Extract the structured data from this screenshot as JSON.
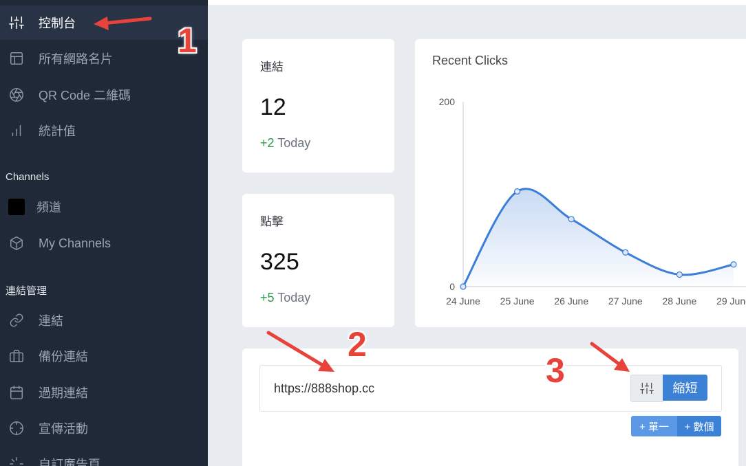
{
  "sidebar": {
    "items": [
      {
        "label": "控制台",
        "icon": "sliders-icon",
        "active": true
      },
      {
        "label": "所有網路名片",
        "icon": "layout-icon"
      },
      {
        "label": "QR Code 二維碼",
        "icon": "aperture-icon"
      },
      {
        "label": "統計值",
        "icon": "bar-chart-icon"
      }
    ],
    "channels_title": "Channels",
    "channels": [
      {
        "label": "頻道",
        "icon": "black-square-icon"
      },
      {
        "label": "My Channels",
        "icon": "box-icon"
      }
    ],
    "links_title": "連結管理",
    "links": [
      {
        "label": "連結",
        "icon": "link-icon"
      },
      {
        "label": "備份連結",
        "icon": "briefcase-icon"
      },
      {
        "label": "過期連結",
        "icon": "calendar-icon"
      },
      {
        "label": "宣傳活動",
        "icon": "crosshair-icon"
      },
      {
        "label": "自訂廣告頁",
        "icon": "loader-icon"
      }
    ]
  },
  "stats": {
    "links": {
      "title": "連結",
      "value": "12",
      "delta": "+2",
      "delta_suffix": "Today"
    },
    "clicks": {
      "title": "點擊",
      "value": "325",
      "delta": "+5",
      "delta_suffix": "Today"
    }
  },
  "chart_data": {
    "type": "area",
    "title": "Recent Clicks",
    "categories": [
      "24 June",
      "25 June",
      "26 June",
      "27 June",
      "28 June",
      "29 June"
    ],
    "values": [
      0,
      103,
      73,
      37,
      13,
      24
    ],
    "ylim": [
      0,
      200
    ],
    "yticks": [
      "0",
      "200"
    ],
    "color": "#3b7dd8",
    "grid": false
  },
  "shortener": {
    "url_value": "https://888shop.cc",
    "shorten_label": "縮短",
    "options_icon": "sliders-icon",
    "single_label": "+ 單一",
    "multiple_label": "+ 數個"
  },
  "annotations": {
    "one": "1",
    "two": "2",
    "three": "3",
    "color": "#e8433a"
  }
}
